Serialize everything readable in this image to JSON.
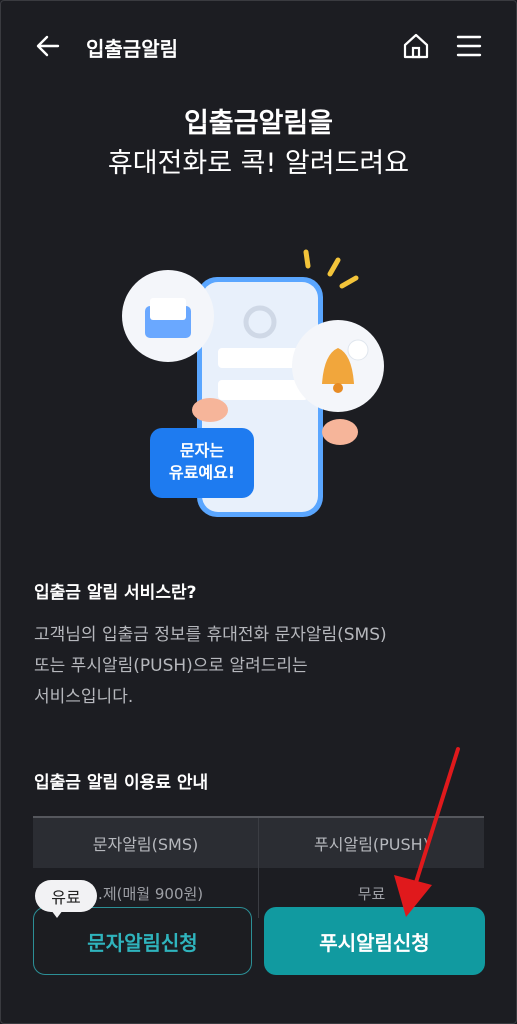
{
  "header": {
    "title": "입출금알림",
    "back_icon": "arrow-left-icon",
    "home_icon": "home-icon",
    "menu_icon": "hamburger-menu-icon"
  },
  "headline": {
    "line1": "입출금알림을",
    "line2": "휴대전화로 콕! 알려드려요"
  },
  "illustration": {
    "tag_line1": "문자는",
    "tag_line2": "유료예요!"
  },
  "service": {
    "title": "입출금 알림 서비스란?",
    "desc_line1": "고객님의 입출금 정보를 휴대전화 문자알림(SMS)",
    "desc_line2": "또는 푸시알림(PUSH)으로 알려드리는",
    "desc_line3": "서비스입니다."
  },
  "fee": {
    "title": "입출금 알림 이용료 안내",
    "columns": [
      "문자알림(SMS)",
      "푸시알림(PUSH)"
    ],
    "row": [
      "…제(매월 900원)",
      "무료"
    ]
  },
  "buttons": {
    "badge": "유료",
    "sms": "문자알림신청",
    "push": "푸시알림신청"
  },
  "colors": {
    "accent": "#119aa0",
    "annotation": "#e0191c",
    "tag_blue": "#1e7bf0"
  }
}
